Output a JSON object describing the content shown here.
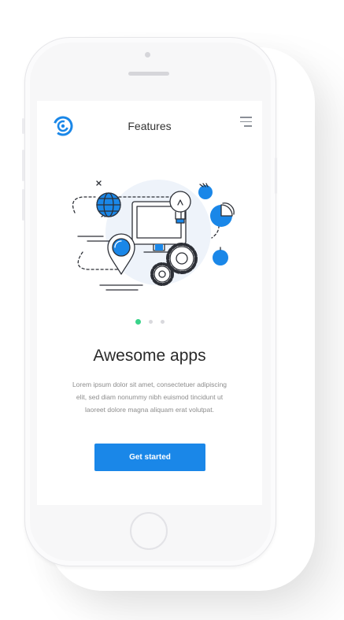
{
  "header": {
    "title": "Features"
  },
  "icons": {
    "logo": "logo-icon",
    "menu": "hamburger-menu-icon"
  },
  "colors": {
    "accent": "#1a87e8",
    "active_dot": "#39d38a",
    "illustration_bg": "#eef3fa"
  },
  "pager": {
    "total": 3,
    "active": 1
  },
  "content": {
    "headline": "Awesome apps",
    "body": "Lorem ipsum dolor sit amet, consectetuer adipiscing elit, sed diam nonummy nibh euismod tincidunt ut laoreet dolore magna aliquam erat volutpat.",
    "cta_label": "Get started"
  }
}
